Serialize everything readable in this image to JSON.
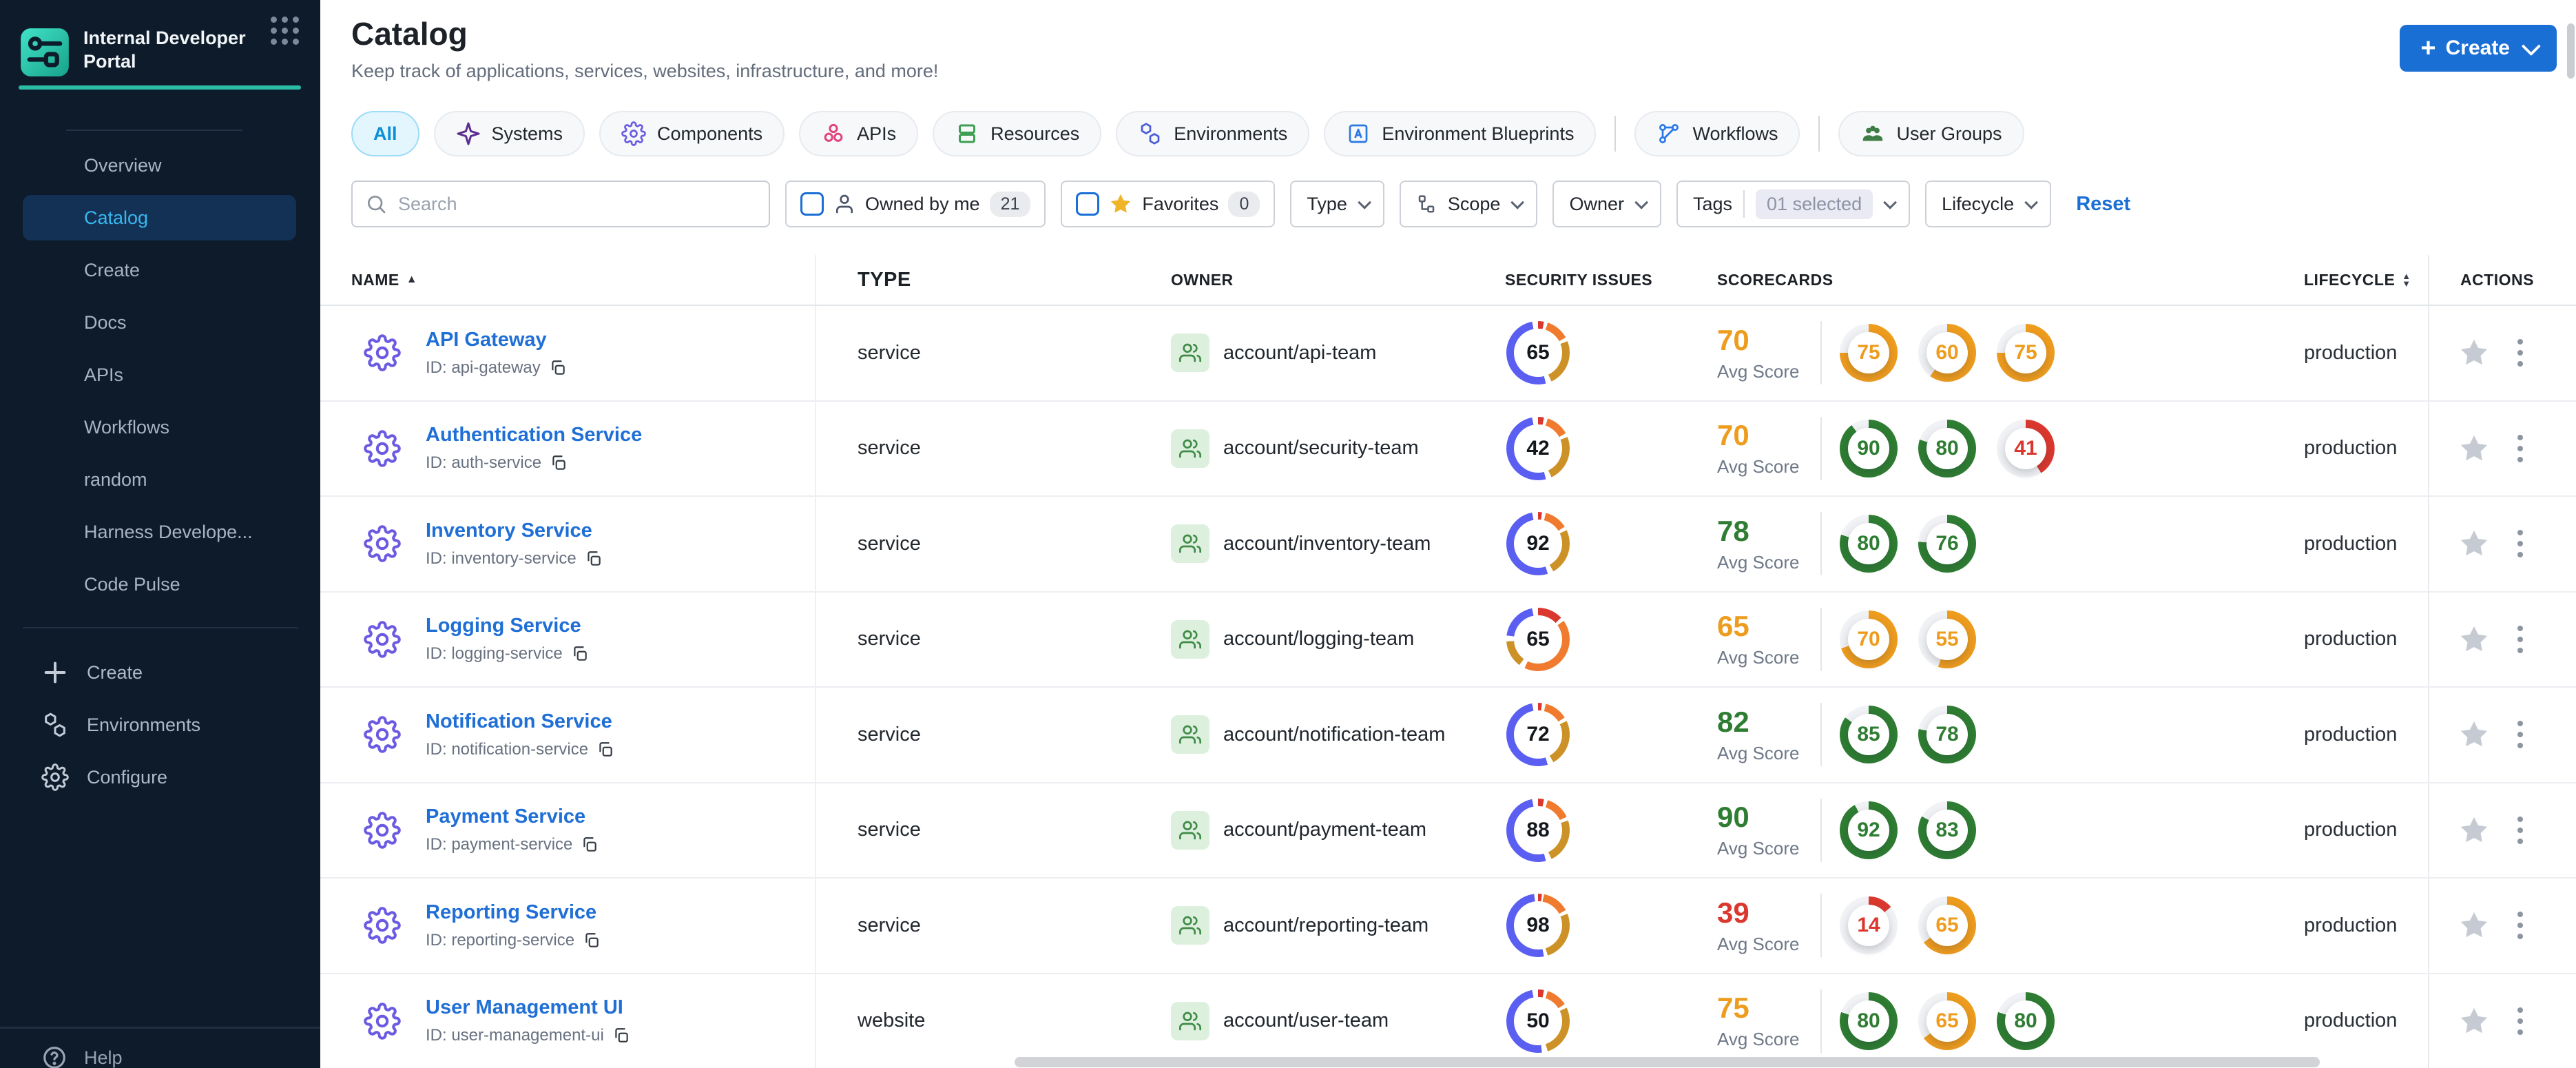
{
  "sidebar": {
    "logo_title": "Internal Developer Portal",
    "nav": [
      {
        "label": "Overview",
        "active": false
      },
      {
        "label": "Catalog",
        "active": true
      },
      {
        "label": "Create",
        "active": false
      },
      {
        "label": "Docs",
        "active": false
      },
      {
        "label": "APIs",
        "active": false
      },
      {
        "label": "Workflows",
        "active": false
      },
      {
        "label": "random",
        "active": false
      },
      {
        "label": "Harness Develope...",
        "active": false
      },
      {
        "label": "Code Pulse",
        "active": false
      }
    ],
    "bottom_nav": [
      {
        "label": "Create",
        "icon": "plus"
      },
      {
        "label": "Environments",
        "icon": "hexagons"
      },
      {
        "label": "Configure",
        "icon": "gear"
      }
    ],
    "help_label": "Help"
  },
  "header": {
    "title": "Catalog",
    "subtitle": "Keep track of applications, services, websites, infrastructure, and more!",
    "create_button": "Create"
  },
  "tabs": [
    {
      "label": "All",
      "icon": "",
      "color": "",
      "selected": true,
      "divider_before": false
    },
    {
      "label": "Systems",
      "icon": "systems",
      "color": "#5b2d8e",
      "selected": false,
      "divider_before": false
    },
    {
      "label": "Components",
      "icon": "components",
      "color": "#6a5be2",
      "selected": false,
      "divider_before": false
    },
    {
      "label": "APIs",
      "icon": "apis",
      "color": "#e0447c",
      "selected": false,
      "divider_before": false
    },
    {
      "label": "Resources",
      "icon": "resources",
      "color": "#3e9e52",
      "selected": false,
      "divider_before": false
    },
    {
      "label": "Environments",
      "icon": "environments",
      "color": "#4a5cd8",
      "selected": false,
      "divider_before": false
    },
    {
      "label": "Environment Blueprints",
      "icon": "blueprints",
      "color": "#2a78e4",
      "selected": false,
      "divider_before": false
    },
    {
      "label": "Workflows",
      "icon": "workflows",
      "color": "#2a78e4",
      "selected": false,
      "divider_before": true
    },
    {
      "label": "User Groups",
      "icon": "usergroups",
      "color": "#3e7d46",
      "selected": false,
      "divider_before": true
    }
  ],
  "filters": {
    "search_placeholder": "Search",
    "owned_by_me": {
      "label": "Owned by me",
      "count": "21"
    },
    "favorites": {
      "label": "Favorites",
      "count": "0"
    },
    "type_label": "Type",
    "scope_label": "Scope",
    "owner_label": "Owner",
    "tags_label": "Tags",
    "tags_value": "01 selected",
    "lifecycle_label": "Lifecycle",
    "reset_label": "Reset"
  },
  "table": {
    "columns": {
      "name": "NAME",
      "type": "TYPE",
      "owner": "OWNER",
      "security": "SECURITY ISSUES",
      "scorecards": "SCORECARDS",
      "lifecycle": "LIFECYCLE",
      "actions": "ACTIONS"
    },
    "avg_score_label": "Avg Score",
    "rows": [
      {
        "name": "API Gateway",
        "id_label": "ID: api-gateway",
        "type": "service",
        "owner": "account/api-team",
        "security": {
          "value": "65",
          "segments": [
            [
              "#da382e",
              0,
              3
            ],
            [
              "#f07b2e",
              5,
              17
            ],
            [
              "#cd9227",
              19,
              43
            ],
            [
              "#5a5ff2",
              46,
              97
            ]
          ]
        },
        "avg": {
          "value": "70",
          "color": "#ee9c1e"
        },
        "rings": [
          {
            "value": "75",
            "pct": 75,
            "color": "#ee9c1e"
          },
          {
            "value": "60",
            "pct": 60,
            "color": "#ee9c1e"
          },
          {
            "value": "75",
            "pct": 75,
            "color": "#ee9c1e"
          }
        ],
        "lifecycle": "production"
      },
      {
        "name": "Authentication Service",
        "id_label": "ID: auth-service",
        "type": "service",
        "owner": "account/security-team",
        "security": {
          "value": "42",
          "segments": [
            [
              "#da382e",
              0,
              3
            ],
            [
              "#f07b2e",
              5,
              17
            ],
            [
              "#cd9227",
              19,
              43
            ],
            [
              "#5a5ff2",
              46,
              97
            ]
          ]
        },
        "avg": {
          "value": "70",
          "color": "#ee9c1e"
        },
        "rings": [
          {
            "value": "90",
            "pct": 90,
            "color": "#2e7d32"
          },
          {
            "value": "80",
            "pct": 80,
            "color": "#2e7d32"
          },
          {
            "value": "41",
            "pct": 41,
            "color": "#da382e"
          }
        ],
        "lifecycle": "production"
      },
      {
        "name": "Inventory Service",
        "id_label": "ID: inventory-service",
        "type": "service",
        "owner": "account/inventory-team",
        "security": {
          "value": "92",
          "segments": [
            [
              "#da382e",
              0,
              2
            ],
            [
              "#f07b2e",
              4,
              16
            ],
            [
              "#cd9227",
              18,
              42
            ],
            [
              "#5a5ff2",
              45,
              97
            ]
          ]
        },
        "avg": {
          "value": "78",
          "color": "#2e7d32"
        },
        "rings": [
          {
            "value": "80",
            "pct": 80,
            "color": "#2e7d32"
          },
          {
            "value": "76",
            "pct": 76,
            "color": "#2e7d32"
          }
        ],
        "lifecycle": "production"
      },
      {
        "name": "Logging Service",
        "id_label": "ID: logging-service",
        "type": "service",
        "owner": "account/logging-team",
        "security": {
          "value": "65",
          "segments": [
            [
              "#da382e",
              0,
              13
            ],
            [
              "#f07b2e",
              15,
              57
            ],
            [
              "#cd9227",
              60,
              74
            ],
            [
              "#5a5ff2",
              77,
              97
            ]
          ]
        },
        "avg": {
          "value": "65",
          "color": "#ee9c1e"
        },
        "rings": [
          {
            "value": "70",
            "pct": 70,
            "color": "#ee9c1e"
          },
          {
            "value": "55",
            "pct": 55,
            "color": "#ee9c1e"
          }
        ],
        "lifecycle": "production"
      },
      {
        "name": "Notification Service",
        "id_label": "ID: notification-service",
        "type": "service",
        "owner": "account/notification-team",
        "security": {
          "value": "72",
          "segments": [
            [
              "#da382e",
              0,
              2
            ],
            [
              "#f07b2e",
              4,
              16
            ],
            [
              "#cd9227",
              18,
              42
            ],
            [
              "#5a5ff2",
              45,
              97
            ]
          ]
        },
        "avg": {
          "value": "82",
          "color": "#2e7d32"
        },
        "rings": [
          {
            "value": "85",
            "pct": 85,
            "color": "#2e7d32"
          },
          {
            "value": "78",
            "pct": 78,
            "color": "#2e7d32"
          }
        ],
        "lifecycle": "production"
      },
      {
        "name": "Payment Service",
        "id_label": "ID: payment-service",
        "type": "service",
        "owner": "account/payment-team",
        "security": {
          "value": "88",
          "segments": [
            [
              "#da382e",
              0,
              3
            ],
            [
              "#f07b2e",
              5,
              18
            ],
            [
              "#cd9227",
              20,
              43
            ],
            [
              "#5a5ff2",
              46,
              97
            ]
          ]
        },
        "avg": {
          "value": "90",
          "color": "#2e7d32"
        },
        "rings": [
          {
            "value": "92",
            "pct": 92,
            "color": "#2e7d32"
          },
          {
            "value": "83",
            "pct": 83,
            "color": "#2e7d32"
          }
        ],
        "lifecycle": "production"
      },
      {
        "name": "Reporting Service",
        "id_label": "ID: reporting-service",
        "type": "service",
        "owner": "account/reporting-team",
        "security": {
          "value": "98",
          "segments": [
            [
              "#da382e",
              0,
              2
            ],
            [
              "#f07b2e",
              3,
              17
            ],
            [
              "#cd9227",
              19,
              45
            ],
            [
              "#5a5ff2",
              47,
              98
            ]
          ]
        },
        "avg": {
          "value": "39",
          "color": "#da382e"
        },
        "rings": [
          {
            "value": "14",
            "pct": 14,
            "color": "#da382e"
          },
          {
            "value": "65",
            "pct": 65,
            "color": "#ee9c1e"
          }
        ],
        "lifecycle": "production"
      },
      {
        "name": "User Management UI",
        "id_label": "ID: user-management-ui",
        "type": "website",
        "owner": "account/user-team",
        "security": {
          "value": "50",
          "segments": [
            [
              "#da382e",
              0,
              3
            ],
            [
              "#f07b2e",
              5,
              16
            ],
            [
              "#cd9227",
              18,
              45
            ],
            [
              "#5a5ff2",
              48,
              97
            ]
          ]
        },
        "avg": {
          "value": "75",
          "color": "#ee9c1e"
        },
        "rings": [
          {
            "value": "80",
            "pct": 80,
            "color": "#2e7d32"
          },
          {
            "value": "65",
            "pct": 65,
            "color": "#ee9c1e"
          },
          {
            "value": "80",
            "pct": 80,
            "color": "#2e7d32"
          }
        ],
        "lifecycle": "production"
      }
    ]
  },
  "colors": {
    "accent_blue": "#1a6fd4",
    "teal": "#2abda4",
    "green": "#2e7d32",
    "orange": "#ee9c1e",
    "red": "#da382e"
  }
}
